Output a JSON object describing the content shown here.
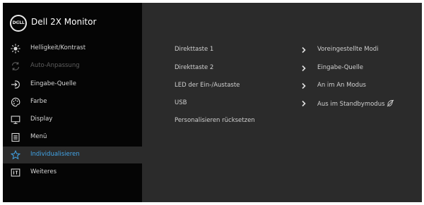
{
  "app": {
    "logo_text": "D∈LL",
    "title": "Dell 2X Monitor"
  },
  "sidebar": {
    "items": [
      {
        "label": "Helligkeit/Kontrast",
        "icon": "brightness-icon",
        "state": "normal"
      },
      {
        "label": "Auto-Anpassung",
        "icon": "auto-adjust-icon",
        "state": "disabled"
      },
      {
        "label": "Eingabe-Quelle",
        "icon": "input-source-icon",
        "state": "normal"
      },
      {
        "label": "Farbe",
        "icon": "color-icon",
        "state": "normal"
      },
      {
        "label": "Display",
        "icon": "display-icon",
        "state": "normal"
      },
      {
        "label": "Menü",
        "icon": "menu-icon",
        "state": "normal"
      },
      {
        "label": "Individualisieren",
        "icon": "star-icon",
        "state": "selected"
      },
      {
        "label": "Weiteres",
        "icon": "info-icon",
        "state": "normal"
      }
    ]
  },
  "content": {
    "rows": [
      {
        "name": "Direkttaste 1",
        "value": "Voreingestellte Modi"
      },
      {
        "name": "Direkttaste 2",
        "value": "Eingabe-Quelle"
      },
      {
        "name": "LED der Ein-/Austaste",
        "value": "An im An Modus"
      },
      {
        "name": "USB",
        "value": "Aus im Standbymodus",
        "value_icon": "power-saving-icon"
      },
      {
        "name": "Personalisieren rücksetzen"
      }
    ]
  },
  "colors": {
    "panel": "#2b2b2b",
    "sidebar": "#050505",
    "accent": "#42a5e8",
    "text": "#d0d0d0",
    "disabled": "#5e5e5e"
  }
}
